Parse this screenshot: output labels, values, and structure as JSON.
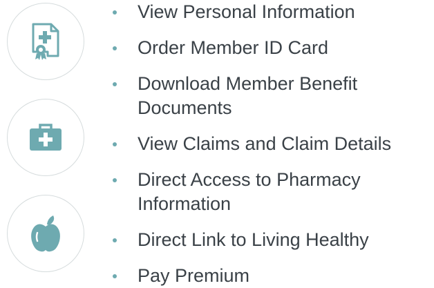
{
  "icons": [
    {
      "name": "medical-certificate-icon",
      "color": "#6eaab0"
    },
    {
      "name": "medical-kit-icon",
      "color": "#6eaab0"
    },
    {
      "name": "apple-icon",
      "color": "#6eaab0"
    }
  ],
  "features": [
    {
      "line1": "View Personal Information"
    },
    {
      "line1": "Order Member ID Card"
    },
    {
      "line1": "Download Member Benefit",
      "line2": "Documents"
    },
    {
      "line1": "View Claims and Claim Details"
    },
    {
      "line1": "Direct Access to Pharmacy",
      "line2": "Information"
    },
    {
      "line1": "Direct Link to Living Healthy"
    },
    {
      "line1": "Pay Premium"
    }
  ],
  "colors": {
    "accent": "#6eaab0",
    "text": "#3a4147",
    "circle_border": "#d6dcdd"
  }
}
